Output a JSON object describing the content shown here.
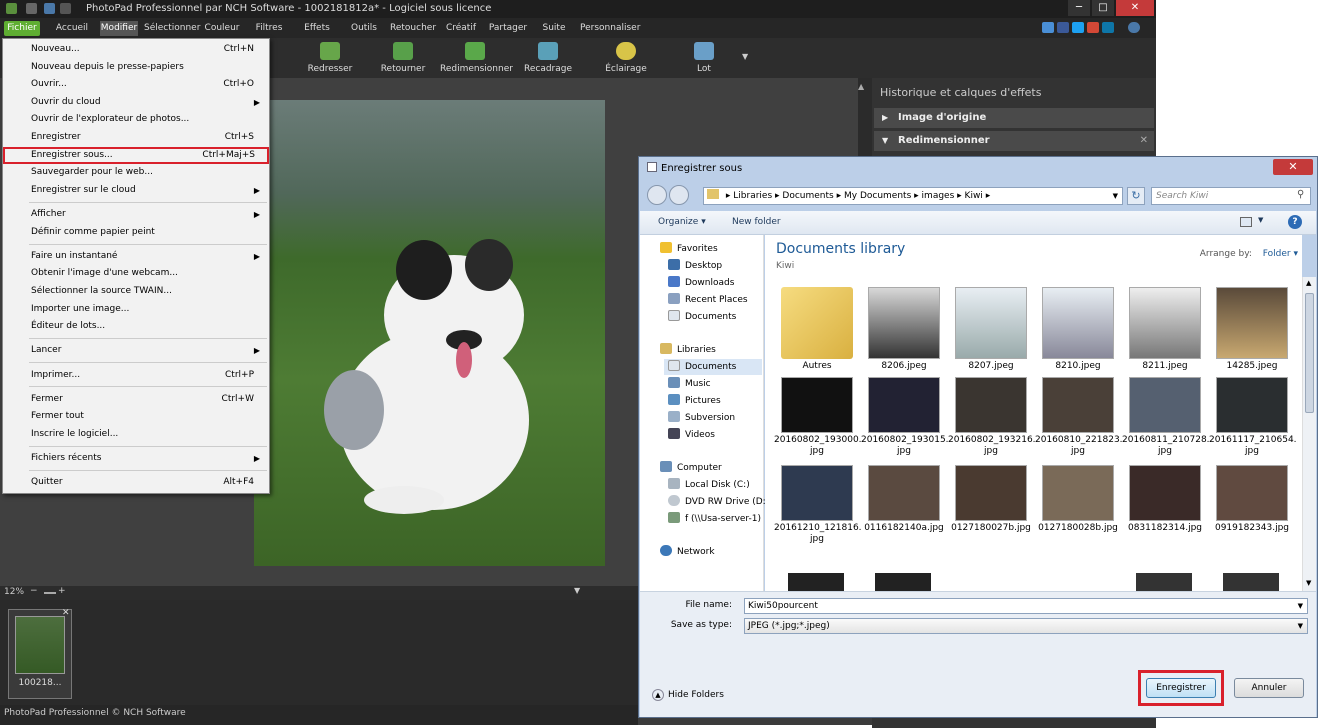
{
  "app": {
    "title": "PhotoPad Professionnel par NCH Software - 1002181812a* - Logiciel sous licence",
    "window_close": "✕",
    "menu_tabs": [
      "Fichier",
      "Accueil",
      "Modifier",
      "Sélectionner",
      "Couleur",
      "Filtres",
      "Effets",
      "Outils",
      "Retoucher",
      "Créatif",
      "Partager",
      "Suite",
      "Personnaliser"
    ],
    "toolbar": [
      "Redresser",
      "Retourner",
      "Redimensionner",
      "Recadrage",
      "Éclairage",
      "Lot"
    ],
    "panel_title": "Historique et calques d'effets",
    "layers": [
      "Image d'origine",
      "Redimensionner"
    ],
    "zoom": "12%",
    "thumb_label": "100218...",
    "status": "PhotoPad Professionnel  © NCH Software"
  },
  "file_menu": {
    "items": [
      {
        "label": "Nouveau...",
        "shortcut": "Ctrl+N"
      },
      {
        "label": "Nouveau depuis le presse-papiers",
        "shortcut": ""
      },
      {
        "label": "Ouvrir...",
        "shortcut": "Ctrl+O"
      },
      {
        "label": "Ouvrir du cloud",
        "shortcut": ""
      },
      {
        "label": "Ouvrir de l'explorateur de photos...",
        "shortcut": ""
      },
      {
        "label": "Enregistrer",
        "shortcut": "Ctrl+S"
      },
      {
        "label": "Enregistrer sous...",
        "shortcut": "Ctrl+Maj+S"
      },
      {
        "label": "Sauvegarder pour le web...",
        "shortcut": ""
      },
      {
        "label": "Enregistrer sur le cloud",
        "shortcut": ""
      },
      {
        "label": "Afficher",
        "shortcut": ""
      },
      {
        "label": "Définir comme papier peint",
        "shortcut": ""
      },
      {
        "label": "Faire un instantané",
        "shortcut": ""
      },
      {
        "label": "Obtenir l'image d'une webcam...",
        "shortcut": ""
      },
      {
        "label": "Sélectionner la source TWAIN...",
        "shortcut": ""
      },
      {
        "label": "Importer une image...",
        "shortcut": ""
      },
      {
        "label": "Éditeur de lots...",
        "shortcut": ""
      },
      {
        "label": "Lancer",
        "shortcut": ""
      },
      {
        "label": "Imprimer...",
        "shortcut": "Ctrl+P"
      },
      {
        "label": "Fermer",
        "shortcut": "Ctrl+W"
      },
      {
        "label": "Fermer tout",
        "shortcut": ""
      },
      {
        "label": "Inscrire le logiciel...",
        "shortcut": ""
      },
      {
        "label": "Fichiers récents",
        "shortcut": ""
      },
      {
        "label": "Quitter",
        "shortcut": "Alt+F4"
      }
    ]
  },
  "dialog": {
    "title": "Enregistrer sous",
    "close": "✕",
    "breadcrumb": [
      "Libraries",
      "Documents",
      "My Documents",
      "images",
      "Kiwi"
    ],
    "search_placeholder": "Search Kiwi",
    "organize": "Organize",
    "new_folder": "New folder",
    "nav": {
      "favorites": "Favorites",
      "favorites_items": [
        "Desktop",
        "Downloads",
        "Recent Places",
        "Documents"
      ],
      "libraries": "Libraries",
      "libraries_items": [
        "Documents",
        "Music",
        "Pictures",
        "Subversion",
        "Videos"
      ],
      "computer": "Computer",
      "computer_items": [
        "Local Disk (C:)",
        "DVD RW Drive (D:)",
        "f (\\\\Usa-server-1)"
      ],
      "network": "Network"
    },
    "library_title": "Documents library",
    "library_sub": "Kiwi",
    "arrange_label": "Arrange by:",
    "arrange_value": "Folder",
    "files": [
      [
        "Autres",
        ""
      ],
      [
        "8206.jpeg",
        ""
      ],
      [
        "8207.jpeg",
        ""
      ],
      [
        "8210.jpeg",
        ""
      ],
      [
        "8211.jpeg",
        ""
      ],
      [
        "14285.jpeg",
        ""
      ],
      [
        "20160802_193000.",
        "jpg"
      ],
      [
        "20160802_193015.",
        "jpg"
      ],
      [
        "20160802_193216.",
        "jpg"
      ],
      [
        "20160810_221823.",
        "jpg"
      ],
      [
        "20160811_210728.",
        "jpg"
      ],
      [
        "20161117_210654.",
        "jpg"
      ],
      [
        "20161210_121816.",
        "jpg"
      ],
      [
        "0116182140a.jpg",
        ""
      ],
      [
        "0127180027b.jpg",
        ""
      ],
      [
        "0127180028b.jpg",
        ""
      ],
      [
        "0831182314.jpg",
        ""
      ],
      [
        "0919182343.jpg",
        ""
      ]
    ],
    "file_name_label": "File name:",
    "file_name": "Kiwi50pourcent",
    "type_label": "Save as type:",
    "type_value": "JPEG (*.jpg;*.jpeg)",
    "hide_folders": "Hide Folders",
    "save": "Enregistrer",
    "cancel": "Annuler"
  }
}
